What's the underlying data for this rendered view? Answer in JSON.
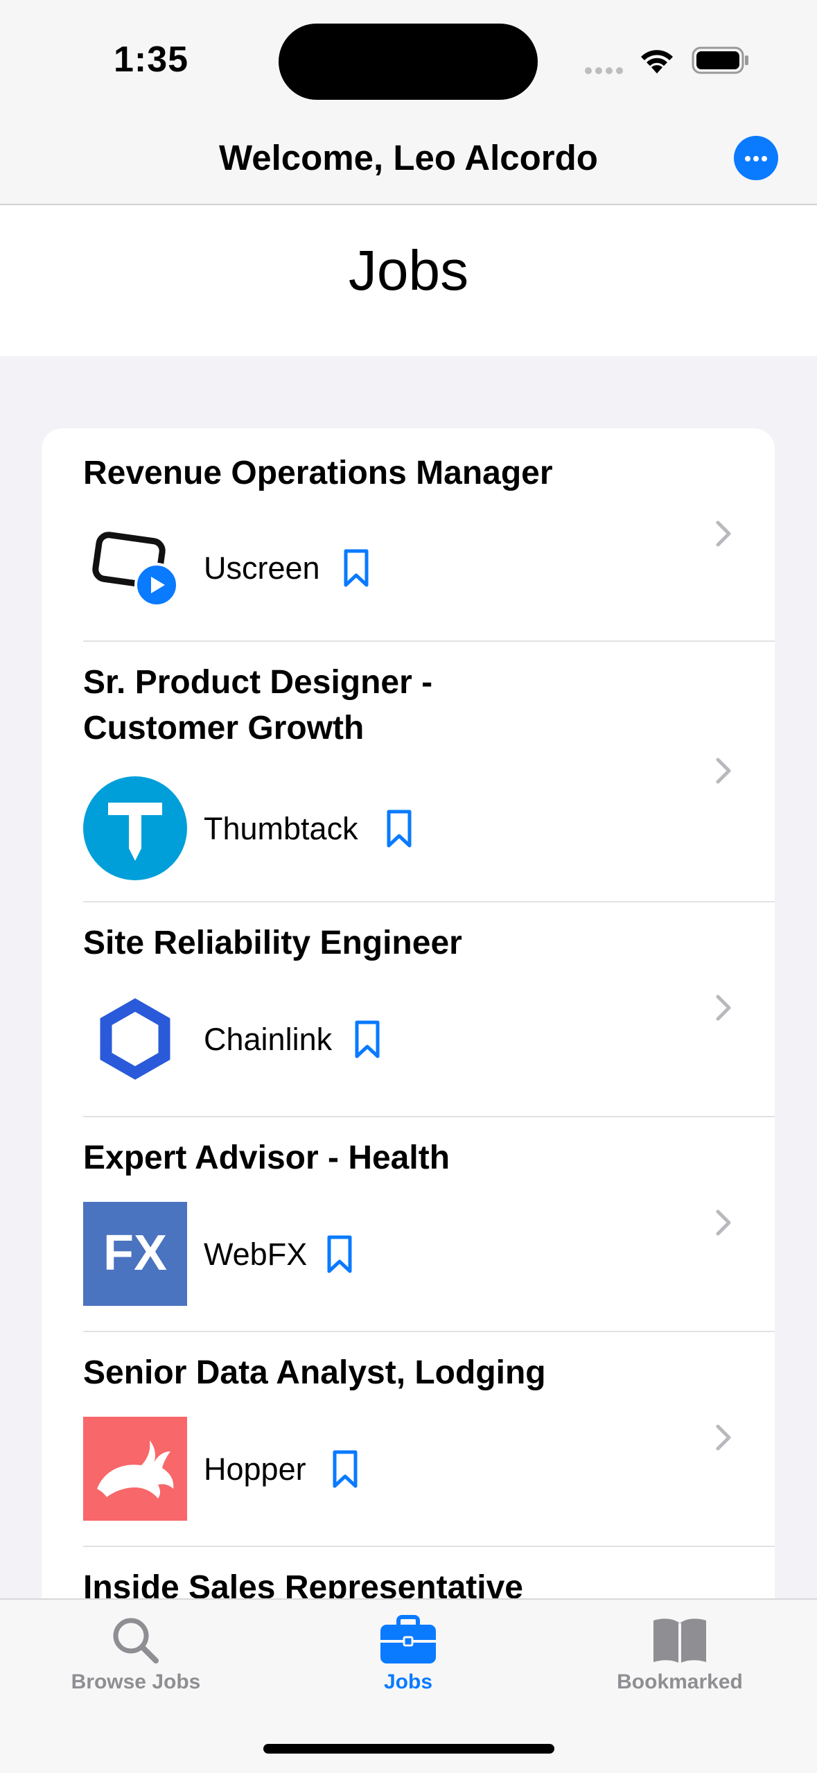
{
  "status_bar": {
    "time": "1:35"
  },
  "nav": {
    "welcome": "Welcome, Leo Alcordo"
  },
  "page": {
    "title": "Jobs"
  },
  "accent_color": "#0a7aff",
  "jobs": [
    {
      "title": "Revenue Operations Manager",
      "company": "Uscreen",
      "logo": "uscreen-logo"
    },
    {
      "title": "Sr. Product Designer -\nCustomer Growth",
      "company": "Thumbtack",
      "logo": "thumbtack-logo"
    },
    {
      "title": "Site Reliability Engineer",
      "company": "Chainlink",
      "logo": "chainlink-logo"
    },
    {
      "title": "Expert Advisor - Health",
      "company": "WebFX",
      "logo": "webfx-logo",
      "logo_text": "FX"
    },
    {
      "title": "Senior Data Analyst, Lodging",
      "company": "Hopper",
      "logo": "hopper-logo"
    },
    {
      "title": "Inside Sales Representative"
    }
  ],
  "tabs": [
    {
      "label": "Browse Jobs",
      "icon": "search-icon",
      "selected": false
    },
    {
      "label": "Jobs",
      "icon": "briefcase-icon",
      "selected": true
    },
    {
      "label": "Bookmarked",
      "icon": "book-icon",
      "selected": false
    }
  ]
}
